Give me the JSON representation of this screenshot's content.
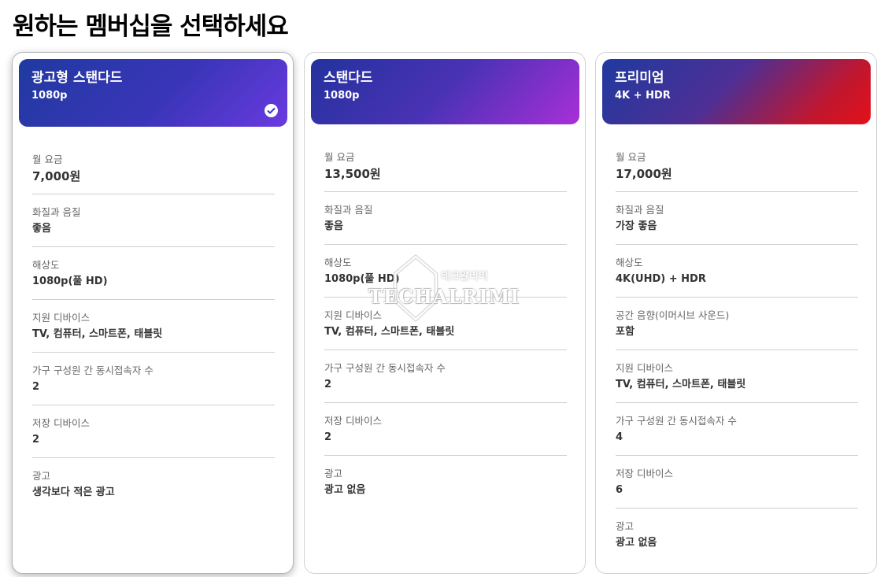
{
  "page": {
    "title": "원하는 멤버십을 선택하세요"
  },
  "plans": [
    {
      "name": "광고형 스탠다드",
      "resolution": "1080p",
      "selected": true,
      "rows": [
        {
          "label": "월 요금",
          "value": "7,000원"
        },
        {
          "label": "화질과 음질",
          "value": "좋음"
        },
        {
          "label": "해상도",
          "value": "1080p(풀 HD)"
        },
        {
          "label": "지원 디바이스",
          "value": "TV, 컴퓨터, 스마트폰, 태블릿"
        },
        {
          "label": "가구 구성원 간 동시접속자 수",
          "value": "2"
        },
        {
          "label": "저장 디바이스",
          "value": "2"
        },
        {
          "label": "광고",
          "value": "생각보다 적은 광고"
        }
      ]
    },
    {
      "name": "스탠다드",
      "resolution": "1080p",
      "selected": false,
      "rows": [
        {
          "label": "월 요금",
          "value": "13,500원"
        },
        {
          "label": "화질과 음질",
          "value": "좋음"
        },
        {
          "label": "해상도",
          "value": "1080p(풀 HD)"
        },
        {
          "label": "지원 디바이스",
          "value": "TV, 컴퓨터, 스마트폰, 태블릿"
        },
        {
          "label": "가구 구성원 간 동시접속자 수",
          "value": "2"
        },
        {
          "label": "저장 디바이스",
          "value": "2"
        },
        {
          "label": "광고",
          "value": "광고 없음"
        }
      ]
    },
    {
      "name": "프리미엄",
      "resolution": "4K + HDR",
      "selected": false,
      "rows": [
        {
          "label": "월 요금",
          "value": "17,000원"
        },
        {
          "label": "화질과 음질",
          "value": "가장 좋음"
        },
        {
          "label": "해상도",
          "value": "4K(UHD) + HDR"
        },
        {
          "label": "공간 음향(이머시브 사운드)",
          "value": "포함"
        },
        {
          "label": "지원 디바이스",
          "value": "TV, 컴퓨터, 스마트폰, 태블릿"
        },
        {
          "label": "가구 구성원 간 동시접속자 수",
          "value": "4"
        },
        {
          "label": "저장 디바이스",
          "value": "6"
        },
        {
          "label": "광고",
          "value": "광고 없음"
        }
      ]
    }
  ],
  "watermark": {
    "brand": "TECHALRIMI",
    "korean": "테크알리미"
  },
  "colors": {
    "selected_check": "#3a35b8",
    "divider": "#cfcfcf"
  }
}
